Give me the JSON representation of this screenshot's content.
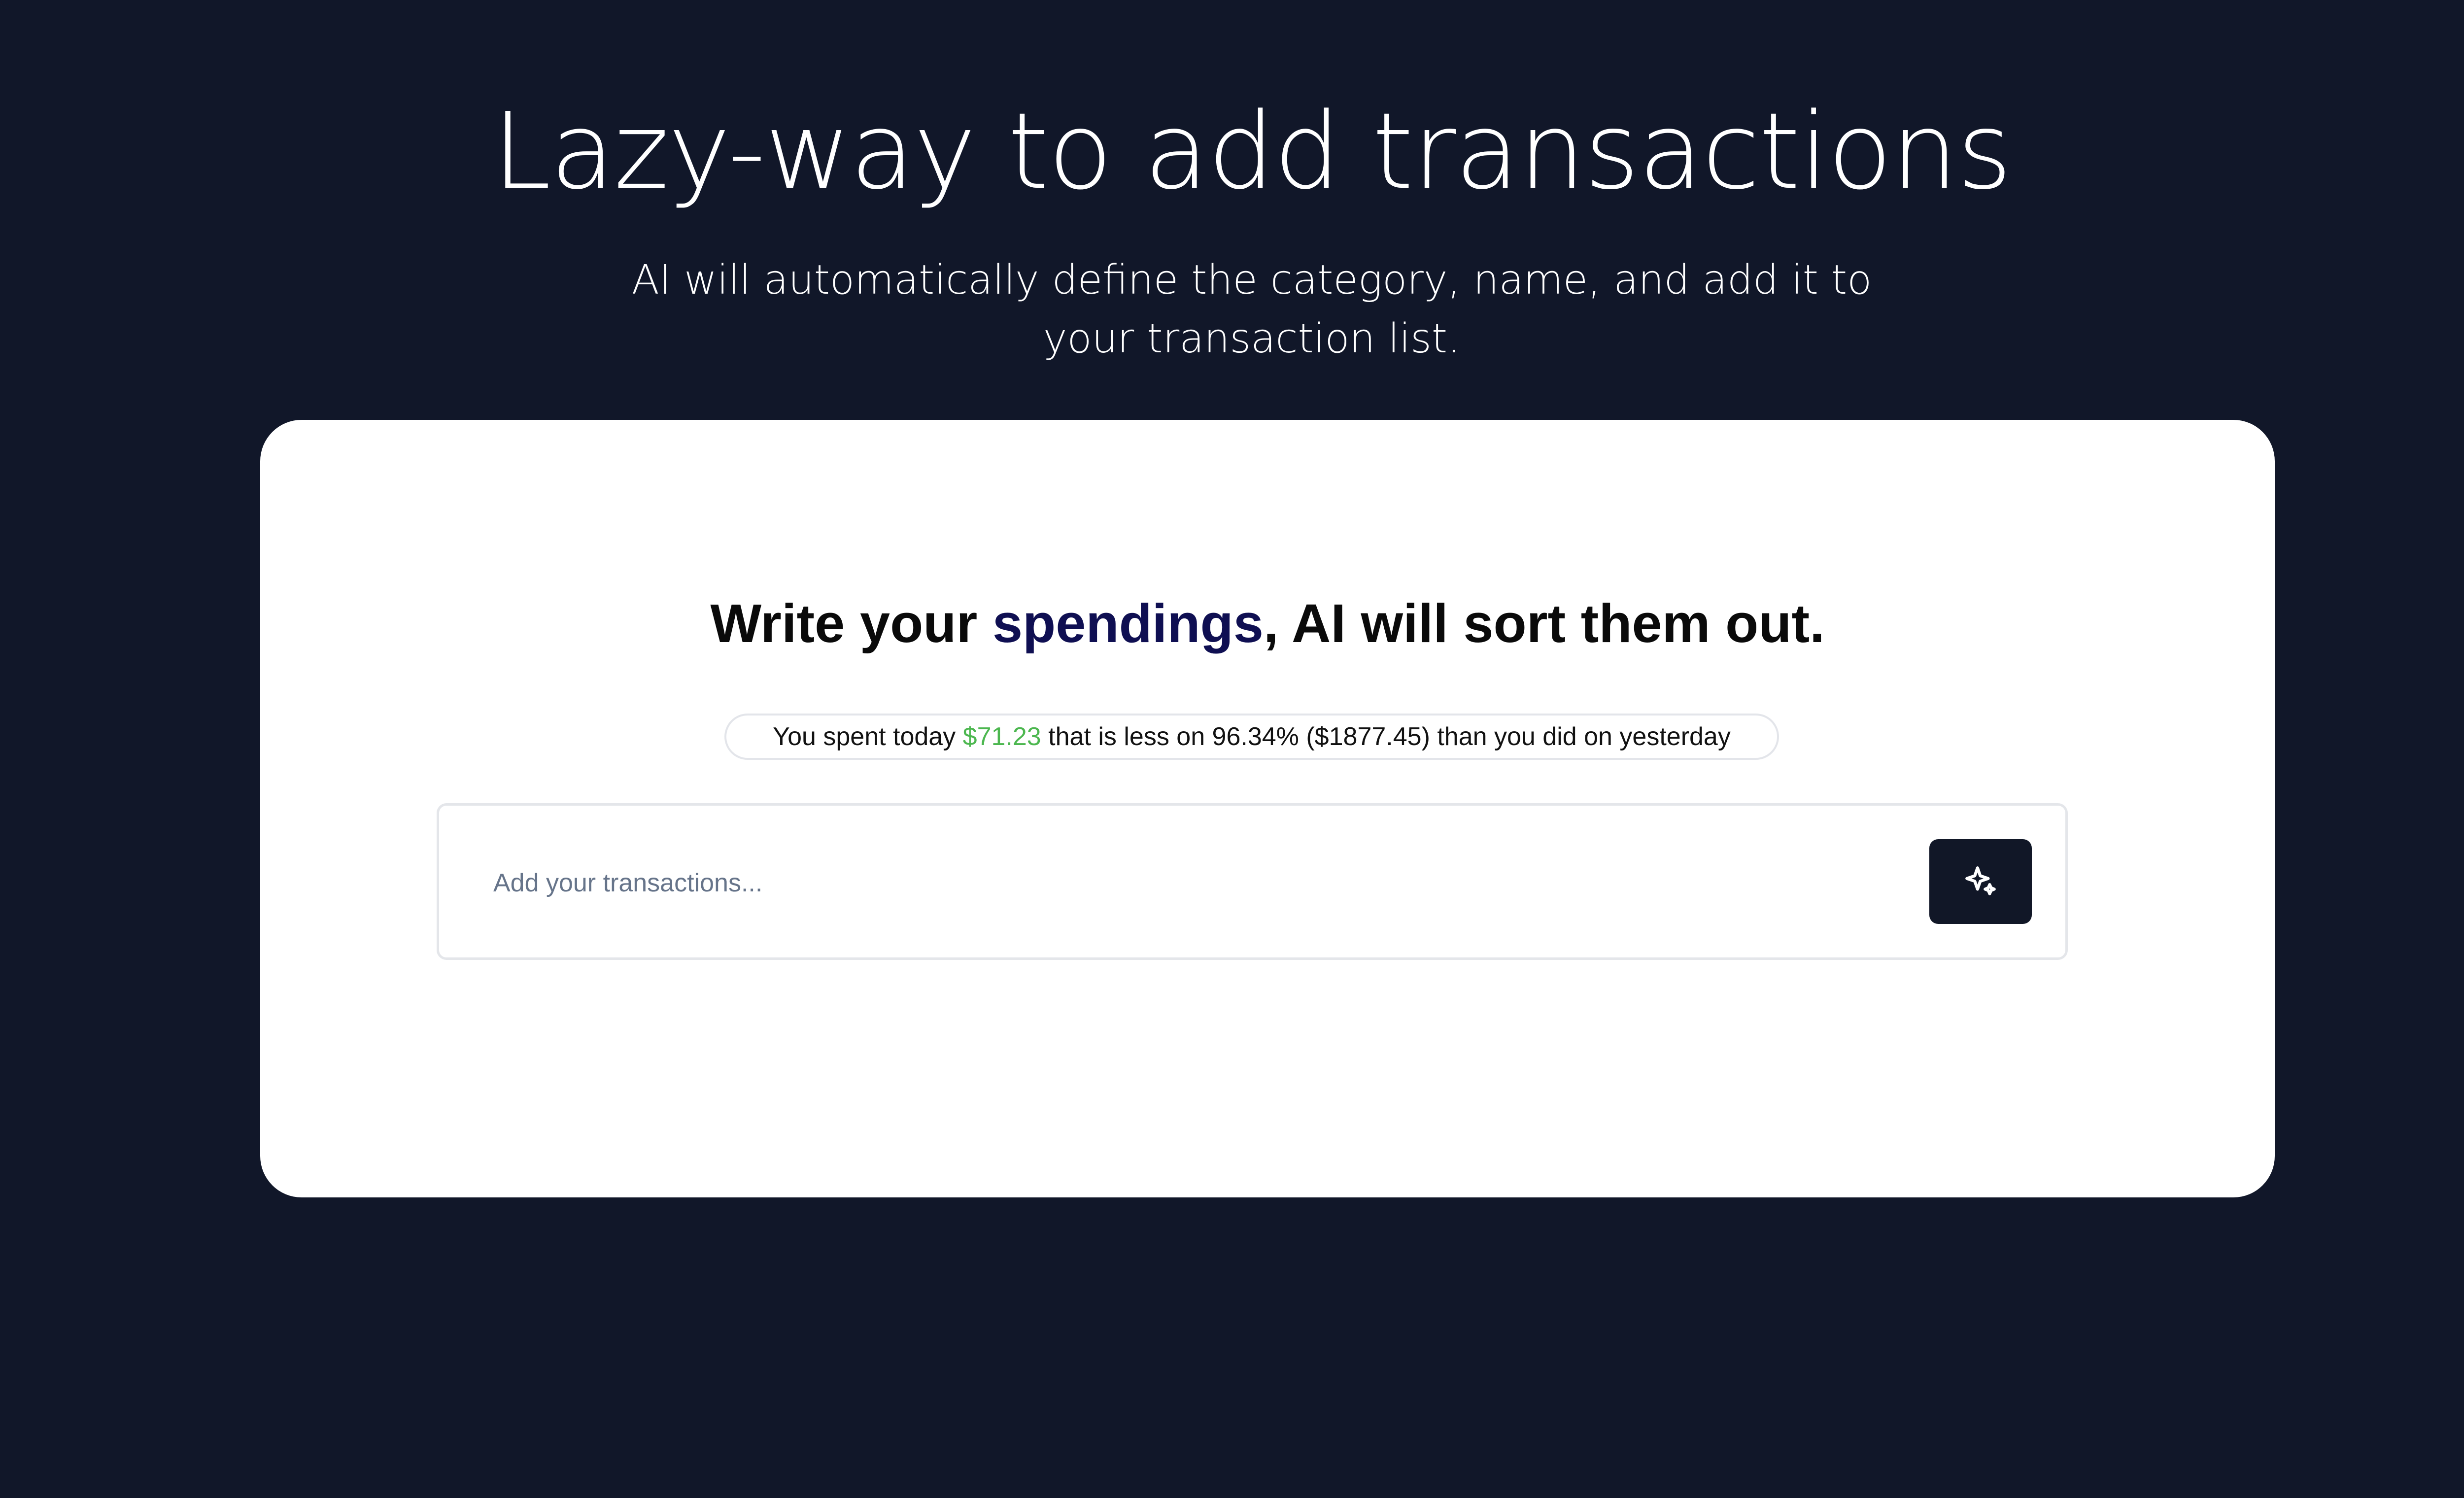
{
  "hero": {
    "title": "Lazy-way to add transactions",
    "subtitle": "AI will automatically define the category, name, and add it to your transaction list."
  },
  "card": {
    "heading_prefix": "Write your ",
    "heading_accent": "spendings",
    "heading_suffix": ", AI will sort them out.",
    "stats": {
      "prefix": "You spent today ",
      "amount": "$71.23",
      "suffix": " that is less on 96.34% ($1877.45) than you did on yesterday"
    },
    "input": {
      "value": "",
      "placeholder": "Add your transactions..."
    },
    "submit_icon": "sparkles-icon"
  },
  "colors": {
    "page_background": "#111729",
    "card_background": "#ffffff",
    "accent_text": "#0f0f52",
    "money_positive": "#4cb74f",
    "button_background": "#111727"
  }
}
